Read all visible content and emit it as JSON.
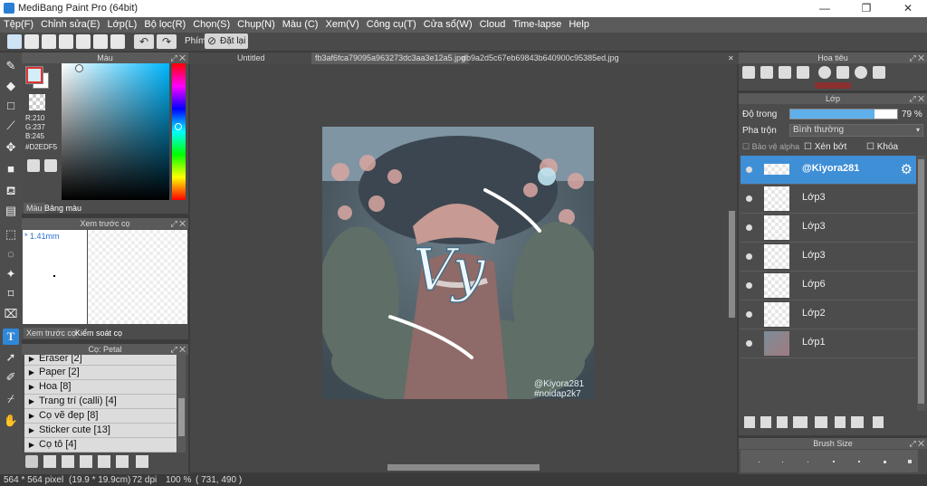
{
  "window": {
    "title": "MediBang Paint Pro (64bit)",
    "minimize": "—",
    "maximize": "❐",
    "close": "✕"
  },
  "menu": [
    "Tệp(F)",
    "Chỉnh sửa(E)",
    "Lớp(L)",
    "Bộ lọc(R)",
    "Chọn(S)",
    "Chụp(N)",
    "Màu (C)",
    "Xem(V)",
    "Công cụ(T)",
    "Cửa sổ(W)",
    "Cloud",
    "Time-lapse",
    "Help"
  ],
  "toolbar": {
    "shortcut_label": "Phím",
    "reset_label": "Đặt lại"
  },
  "color_panel": {
    "title": "Màu",
    "r": "R:210",
    "g": "G:237",
    "b": "B:245",
    "hex": "#D2EDF5",
    "fg_color": "#d2edf5",
    "bg_color": "#ffffff",
    "tab_color": "Màu",
    "tab_palette": "Bảng màu"
  },
  "preview_panel": {
    "title": "Xem trước cọ",
    "size": "* 1.41mm",
    "tab_preview": "Xem trước cọ",
    "tab_control": "Kiểm soát cọ"
  },
  "brush_panel": {
    "title": "Cọ: Petal",
    "items": [
      "Eraser [2]",
      "Paper [2]",
      "Hoa [8]",
      "Trang trí (calli) [4]",
      "Cọ vẽ đẹp [8]",
      "Sticker cute [13]",
      "Cọ tô [4]"
    ]
  },
  "doc_tabs": [
    "Untitled",
    "fb3af6fca79095a963273dc3aa3e12a5.jpg",
    "db9a2d5c67eb69843b640900c95385ed.jpg"
  ],
  "artwork": {
    "watermark_1": "@Kiyora281",
    "watermark_2": "#noidap2k7",
    "script_text": "Vy"
  },
  "nav_panel": {
    "title": "Hoa tiêu"
  },
  "layer_panel": {
    "title": "Lớp",
    "opacity_label": "Độ trong",
    "opacity_value": "79 %",
    "opacity": 0.79,
    "blend_label": "Pha trộn",
    "blend_value": "Bình thường",
    "protect_alpha": "Bảo vệ alpha",
    "clipping": "Xén bớt",
    "lock": "Khóa",
    "layers": [
      "@Kiyora281",
      "Lớp3",
      "Lớp3",
      "Lớp3",
      "Lớp6",
      "Lớp2",
      "Lớp1"
    ]
  },
  "brushsize_panel": {
    "title": "Brush Size"
  },
  "status": {
    "dimensions": "564 * 564 pixel",
    "physical": "(19.9 * 19.9cm)",
    "dpi": "72 dpi",
    "zoom": "100 %",
    "coords": "( 731, 490 )"
  }
}
